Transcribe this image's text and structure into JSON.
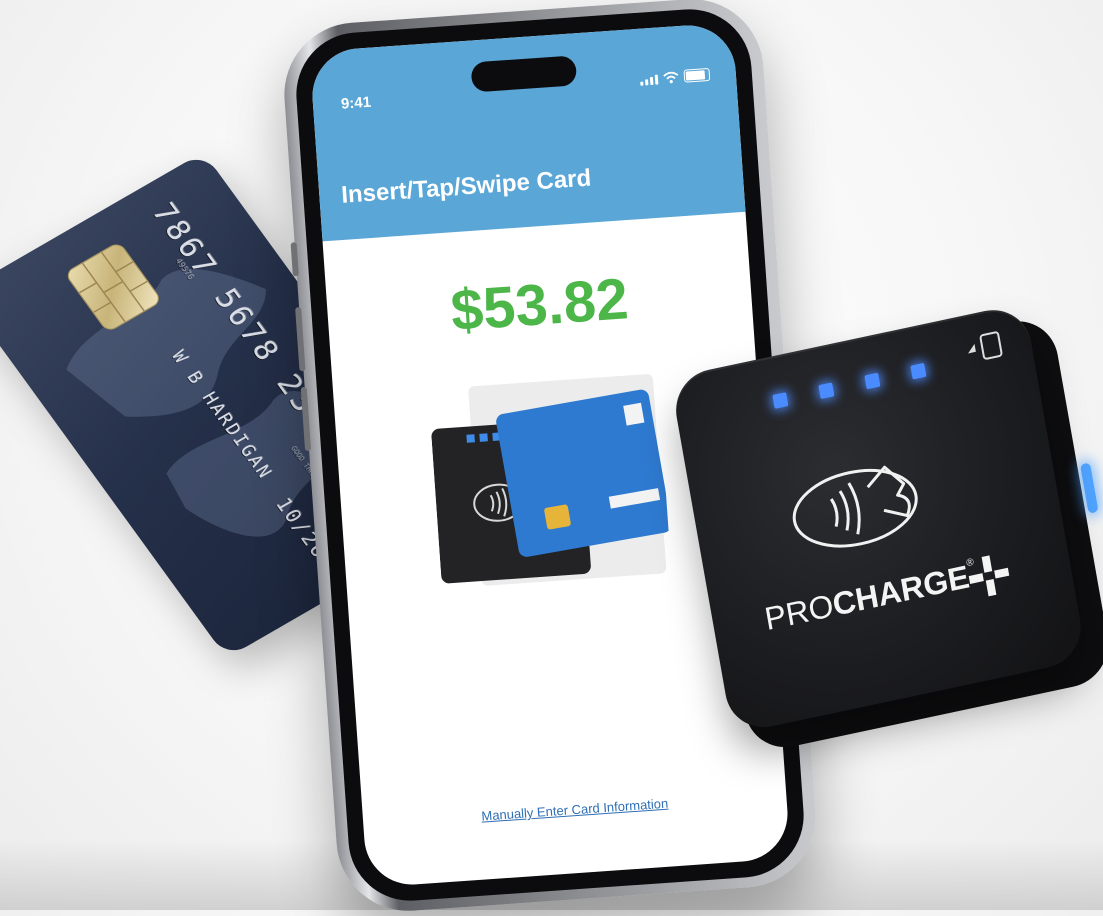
{
  "credit_card": {
    "number": "7867 5678 2364",
    "small_number": "49576",
    "holder": "W B HARDIGAN",
    "good_thru_label": "GOOD THRU",
    "expiry": "10/26"
  },
  "phone": {
    "status_time": "9:41",
    "title": "Insert/Tap/Swipe Card",
    "amount": "$53.82",
    "manual_entry_link": "Manually Enter Card Information"
  },
  "reader": {
    "brand_pro": "PRO",
    "brand_charge": "CHARGE",
    "brand_reg": "®"
  },
  "colors": {
    "header_blue": "#5aa6d6",
    "amount_green": "#4cb648",
    "link_blue": "#2f6fb3",
    "led_blue": "#4a8cff"
  },
  "icons": [
    "signal-icon",
    "wifi-icon",
    "battery-icon",
    "contactless-icon",
    "chip-icon",
    "plus-logo-icon"
  ]
}
